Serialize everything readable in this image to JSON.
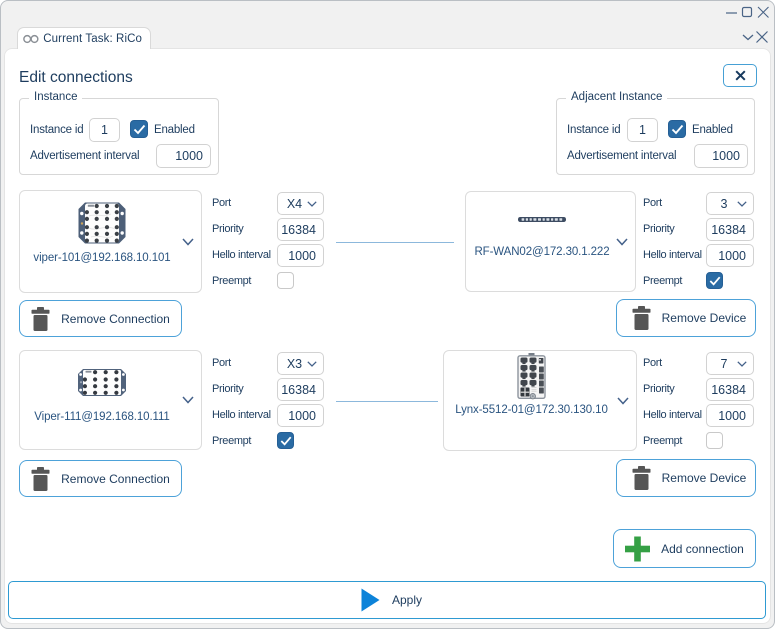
{
  "window_controls": {
    "minimize": "minimize",
    "maximize": "maximize",
    "close": "close"
  },
  "tab": {
    "icon": "link-icon",
    "label": "Current Task: RiCo"
  },
  "dialog": {
    "title": "Edit connections",
    "close_icon": "x-icon",
    "field_labels": {
      "port": "Port",
      "priority": "Priority",
      "hello": "Hello interval",
      "preempt": "Preempt"
    },
    "instance": {
      "legend": "Instance",
      "id_label": "Instance id",
      "id_value": "1",
      "enabled_label": "Enabled",
      "enabled": true,
      "adv_label": "Advertisement interval",
      "adv_value": "1000"
    },
    "adjacent_instance": {
      "legend": "Adjacent Instance",
      "id_label": "Instance id",
      "id_value": "1",
      "enabled_label": "Enabled",
      "enabled": true,
      "adv_label": "Advertisement interval",
      "adv_value": "1000"
    },
    "connections": [
      {
        "left": {
          "device": "viper-101@192.168.10.101",
          "port": "X4",
          "priority": "16384",
          "hello": "1000",
          "preempt": false
        },
        "right": {
          "device": "RF-WAN02@172.30.1.222",
          "port": "3",
          "priority": "16384",
          "hello": "1000",
          "preempt": true
        },
        "remove_connection_label": "Remove Connection",
        "remove_device_label": "Remove Device"
      },
      {
        "left": {
          "device": "Viper-111@192.168.10.111",
          "port": "X3",
          "priority": "16384",
          "hello": "1000",
          "preempt": true
        },
        "right": {
          "device": "Lynx-5512-01@172.30.130.10",
          "port": "7",
          "priority": "16384",
          "hello": "1000",
          "preempt": false
        },
        "remove_connection_label": "Remove Connection",
        "remove_device_label": "Remove Device"
      }
    ],
    "add_connection_label": "Add connection",
    "apply_label": "Apply"
  },
  "colors": {
    "accent_blue": "#2a6ba4",
    "button_border": "#4da2d9",
    "apply_icon": "#0d83d9",
    "add_icon_green": "#35a045",
    "trash_gray": "#565656",
    "text_navy": "#1d3c5e",
    "connection_line": "#8cb8dc"
  }
}
